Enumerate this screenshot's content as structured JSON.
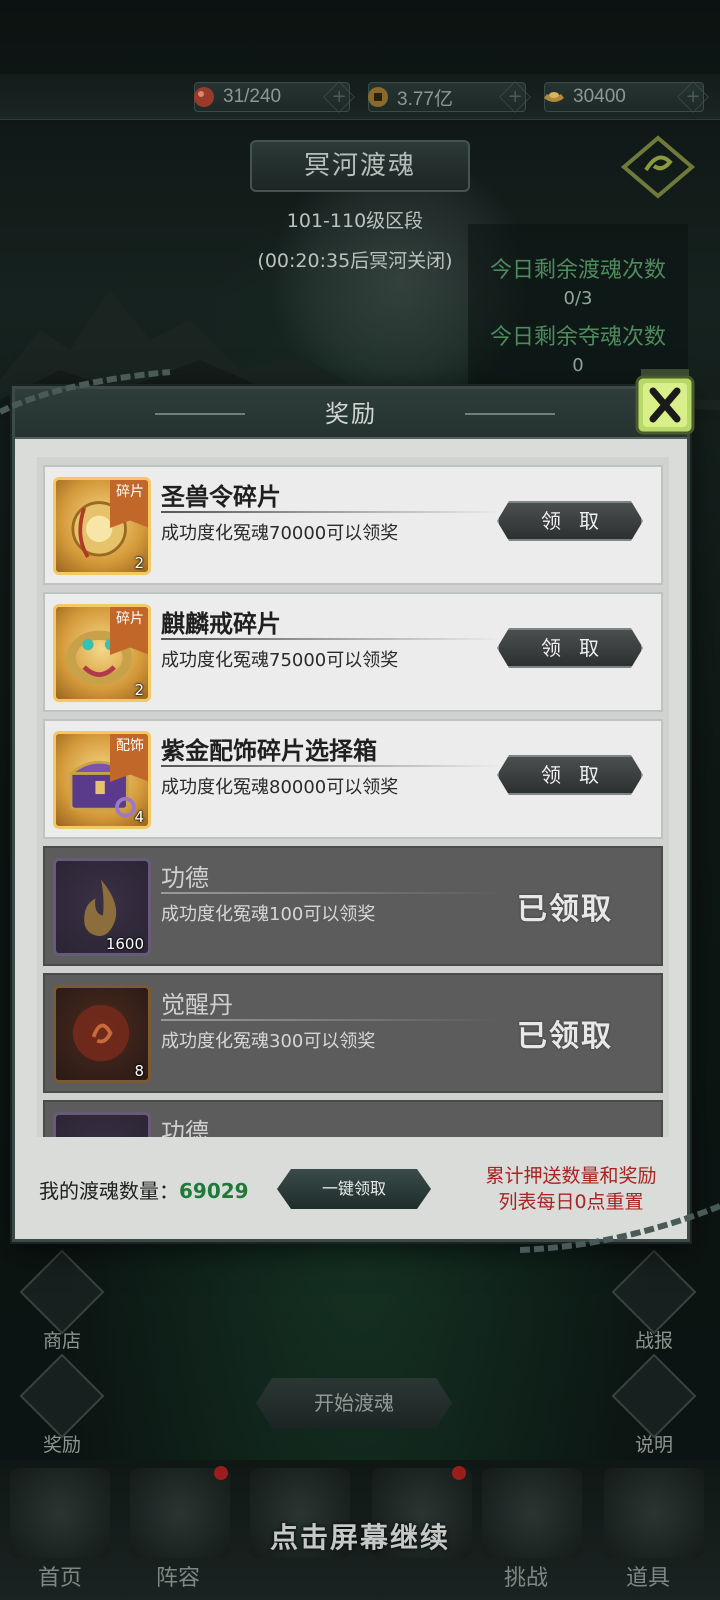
{
  "resources": {
    "stamina": "31/240",
    "coins": "3.77亿",
    "ingots": "30400"
  },
  "header": {
    "title": "冥河渡魂",
    "level_range": "101-110级区段",
    "timer": "(00:20:35后冥河关闭)",
    "ferry_label": "今日剩余渡魂次数",
    "ferry_count": "0/3",
    "rob_label": "今日剩余夺魂次数",
    "rob_count": "0"
  },
  "dialog": {
    "title": "奖励",
    "claim_label": "领取",
    "claimed_label": "已领取",
    "rows": [
      {
        "name": "圣兽令碎片",
        "condition": "成功度化冤魂70000可以领奖",
        "count": "2",
        "tag": "碎片",
        "claimed": false
      },
      {
        "name": "麒麟戒碎片",
        "condition": "成功度化冤魂75000可以领奖",
        "count": "2",
        "tag": "碎片",
        "claimed": false
      },
      {
        "name": "紫金配饰碎片选择箱",
        "condition": "成功度化冤魂80000可以领奖",
        "count": "4",
        "tag": "配饰",
        "claimed": false
      },
      {
        "name": "功德",
        "condition": "成功度化冤魂100可以领奖",
        "count": "1600",
        "claimed": true
      },
      {
        "name": "觉醒丹",
        "condition": "成功度化冤魂300可以领奖",
        "count": "8",
        "claimed": true
      },
      {
        "name": "功德",
        "claimed": true
      }
    ],
    "my_count_label": "我的渡魂数量：",
    "my_count": "69029",
    "onekey_label": "一键领取",
    "reset_note_1": "累计押送数量和奖励",
    "reset_note_2": "列表每日0点重置"
  },
  "side": {
    "shop": "商店",
    "reward": "奖励",
    "report": "战报",
    "help": "说明",
    "start": "开始渡魂"
  },
  "nav": {
    "home": "首页",
    "lineup": "阵容",
    "challenge": "挑战",
    "items": "道具",
    "tap_hint": "点击屏幕继续"
  },
  "colors": {
    "accent_green": "#1f7a3a",
    "note_red": "#a82323",
    "panel": "#d9dcd8"
  }
}
